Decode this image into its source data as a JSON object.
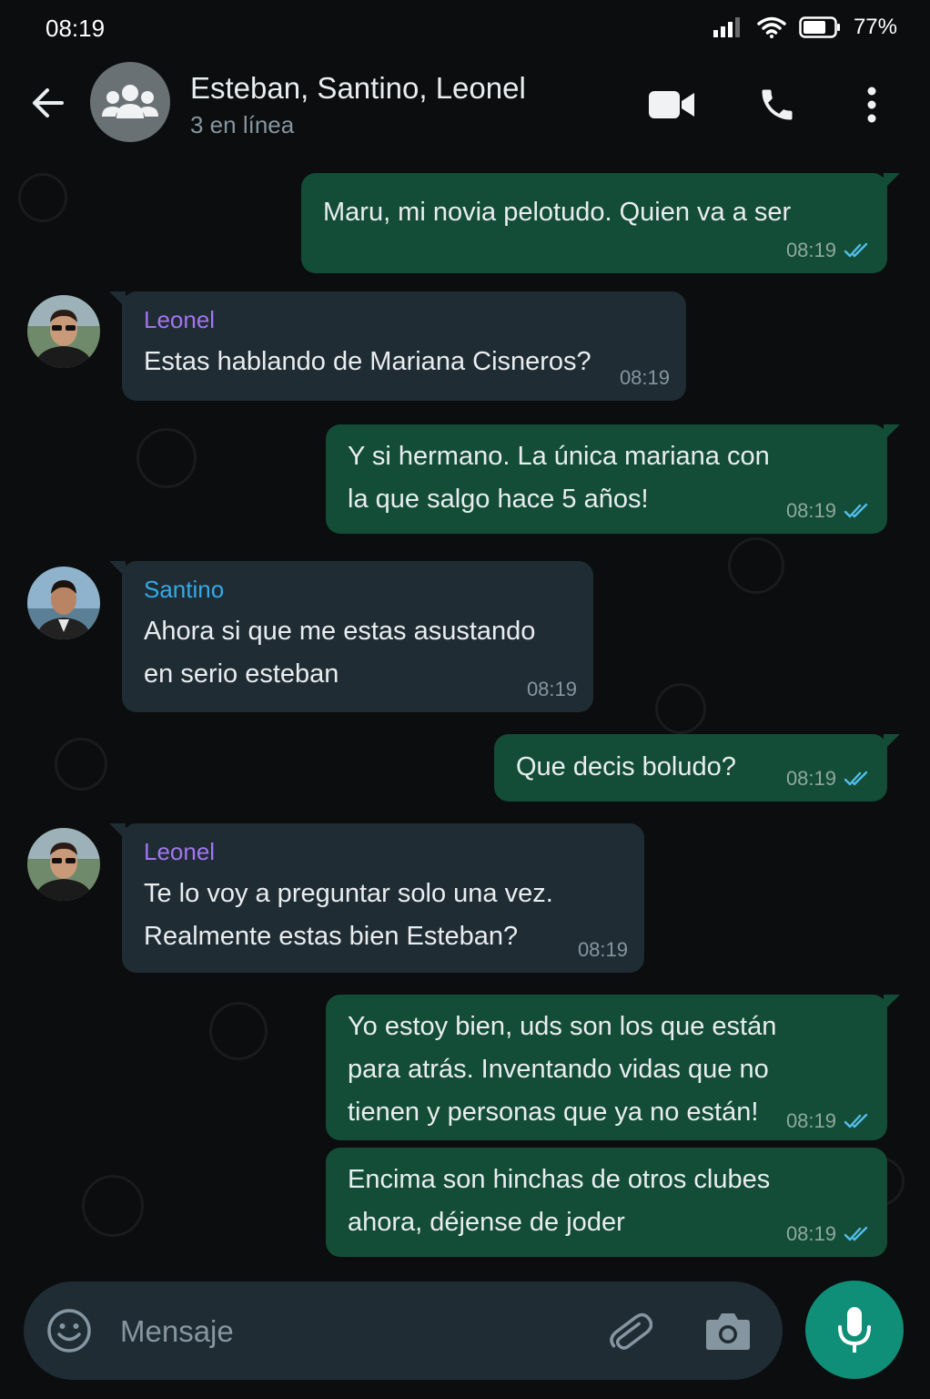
{
  "status_bar": {
    "time": "08:19",
    "battery": "77%"
  },
  "header": {
    "title": "Esteban, Santino, Leonel",
    "subtitle": "3 en línea",
    "icons": [
      "back-arrow-icon",
      "group-icon",
      "video-call-icon",
      "phone-icon",
      "more-vert-icon"
    ]
  },
  "messages": [
    {
      "direction": "out",
      "text": "Maru, mi novia pelotudo. Quien va a ser",
      "time": "08:19",
      "status": "read"
    },
    {
      "direction": "in",
      "sender": "Leonel",
      "sender_color": "#a374f0",
      "text": "Estas hablando de Mariana Cisneros?",
      "time": "08:19"
    },
    {
      "direction": "out",
      "text": "Y si hermano. La única mariana con\nla que salgo hace 5 años!",
      "time": "08:19",
      "status": "read"
    },
    {
      "direction": "in",
      "sender": "Santino",
      "sender_color": "#35a9e6",
      "text": "Ahora si que me estas asustando\nen serio esteban",
      "time": "08:19"
    },
    {
      "direction": "out",
      "text": "Que decis boludo?",
      "time": "08:19",
      "status": "read"
    },
    {
      "direction": "in",
      "sender": "Leonel",
      "sender_color": "#a374f0",
      "text": "Te lo voy a preguntar solo una vez.\nRealmente estas bien Esteban?",
      "time": "08:19"
    },
    {
      "direction": "out",
      "text": "Yo estoy bien, uds son los que están\npara atrás. Inventando vidas que no\ntienen y personas que ya no están!",
      "time": "08:19",
      "status": "read"
    },
    {
      "direction": "out",
      "text": "Encima son hinchas de otros clubes\nahora, déjense de joder",
      "time": "08:19",
      "status": "read"
    }
  ],
  "composer": {
    "placeholder": "Mensaje",
    "icons": [
      "emoji-icon",
      "attach-icon",
      "camera-icon",
      "mic-icon"
    ]
  },
  "colors": {
    "read_ticks": "#53bdeb",
    "outgoing_bubble": "#134d37",
    "incoming_bubble": "#1f2c34",
    "mic_button": "#0f8f77"
  }
}
